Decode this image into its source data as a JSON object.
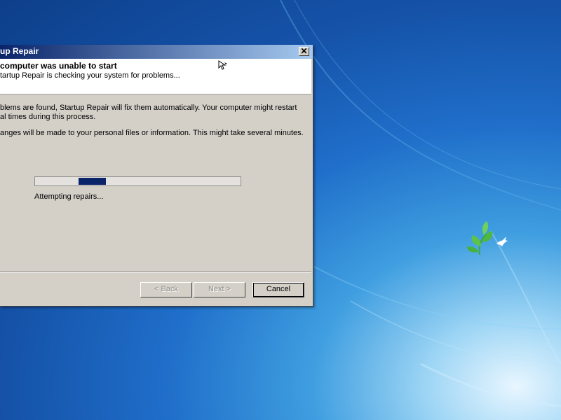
{
  "window": {
    "title": "up Repair",
    "close_glyph": "✕"
  },
  "header": {
    "title": "computer was unable to start",
    "subtitle": "tartup Repair is checking your system for problems..."
  },
  "body": {
    "line1": "blems are found, Startup Repair will fix them automatically. Your computer might restart",
    "line2": "al times during this process.",
    "line3": "anges will be made to your personal files or information. This might take several minutes."
  },
  "progress": {
    "status": "Attempting repairs...",
    "style": "marquee"
  },
  "buttons": {
    "back": "< Back",
    "next": "Next >",
    "cancel": "Cancel"
  },
  "colors": {
    "dialog_face": "#d4d0c8",
    "title_gradient_start": "#0a246a",
    "title_gradient_end": "#a6caf0",
    "progress_chunk": "#0a246a",
    "desktop_blue": "#1552a8"
  },
  "icons": {
    "cursor": "mouse-pointer-icon",
    "desktop_logo": "bird-leaves-logo-icon"
  }
}
